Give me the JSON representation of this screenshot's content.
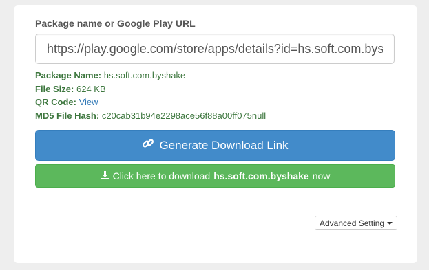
{
  "form": {
    "label": "Package name or Google Play URL",
    "url_value": "https://play.google.com/store/apps/details?id=hs.soft.com.byshake"
  },
  "info": {
    "package_name_key": "Package Name:",
    "package_name_value": "hs.soft.com.byshake",
    "file_size_key": "File Size:",
    "file_size_value": "624 KB",
    "qr_code_key": "QR Code:",
    "qr_code_link": "View",
    "md5_key": "MD5 File Hash:",
    "md5_value": "c20cab31b94e2298ace56f88a00ff075null"
  },
  "buttons": {
    "generate_label": "Generate Download Link",
    "generate_icon": "link-icon",
    "download_prefix": "Click here to download",
    "download_package": "hs.soft.com.byshake",
    "download_suffix": "now",
    "download_icon": "download-icon",
    "advanced_label": "Advanced Setting"
  },
  "colors": {
    "primary": "#428bca",
    "success": "#5cb85c",
    "info_text": "#3c763d",
    "link": "#337ab7"
  }
}
